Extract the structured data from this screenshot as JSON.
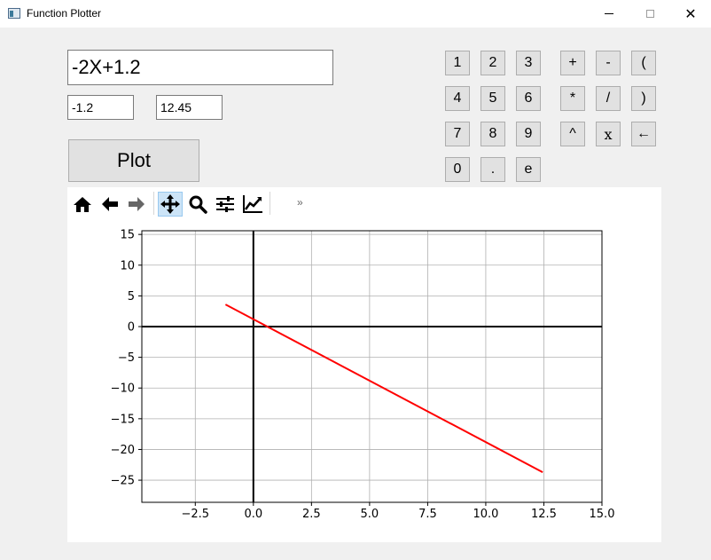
{
  "window": {
    "title": "Function Plotter",
    "minimize_label": "—",
    "close_label": "✕"
  },
  "inputs": {
    "expression": "-2X+1.2",
    "x_min": "-1.2",
    "x_max": "12.45"
  },
  "plot_button_label": "Plot",
  "keypad": {
    "digits": [
      "1",
      "2",
      "3",
      "4",
      "5",
      "6",
      "7",
      "8",
      "9",
      "0",
      ".",
      "e"
    ],
    "operators": [
      "+",
      "-",
      "(",
      "*",
      "/",
      ")",
      "^",
      "x",
      "←"
    ]
  },
  "toolbar": {
    "tools": [
      "home-icon",
      "back-icon",
      "forward-icon",
      "pan-icon",
      "zoom-icon",
      "configure-subplots-icon",
      "edit-axis-icon"
    ],
    "active_tool": "pan-icon",
    "more_label": "»"
  },
  "chart_data": {
    "type": "line",
    "title": "",
    "xlabel": "",
    "ylabel": "",
    "xlim": [
      -4.8,
      15.0
    ],
    "ylim": [
      -28.6,
      15.6
    ],
    "xticks": [
      -2.5,
      0.0,
      2.5,
      5.0,
      7.5,
      10.0,
      12.5,
      15.0
    ],
    "xtick_labels": [
      "−2.5",
      "0.0",
      "2.5",
      "5.0",
      "7.5",
      "10.0",
      "12.5",
      "15.0"
    ],
    "yticks": [
      15,
      10,
      5,
      0,
      -5,
      -10,
      -15,
      -20,
      -25
    ],
    "ytick_labels": [
      "15",
      "10",
      "5",
      "0",
      "−5",
      "−10",
      "−15",
      "−20",
      "−25"
    ],
    "grid": true,
    "axes_lines": true,
    "series": [
      {
        "color": "#ff0000",
        "x": [
          -1.2,
          12.45
        ],
        "y": [
          3.6,
          -23.7
        ]
      }
    ]
  }
}
